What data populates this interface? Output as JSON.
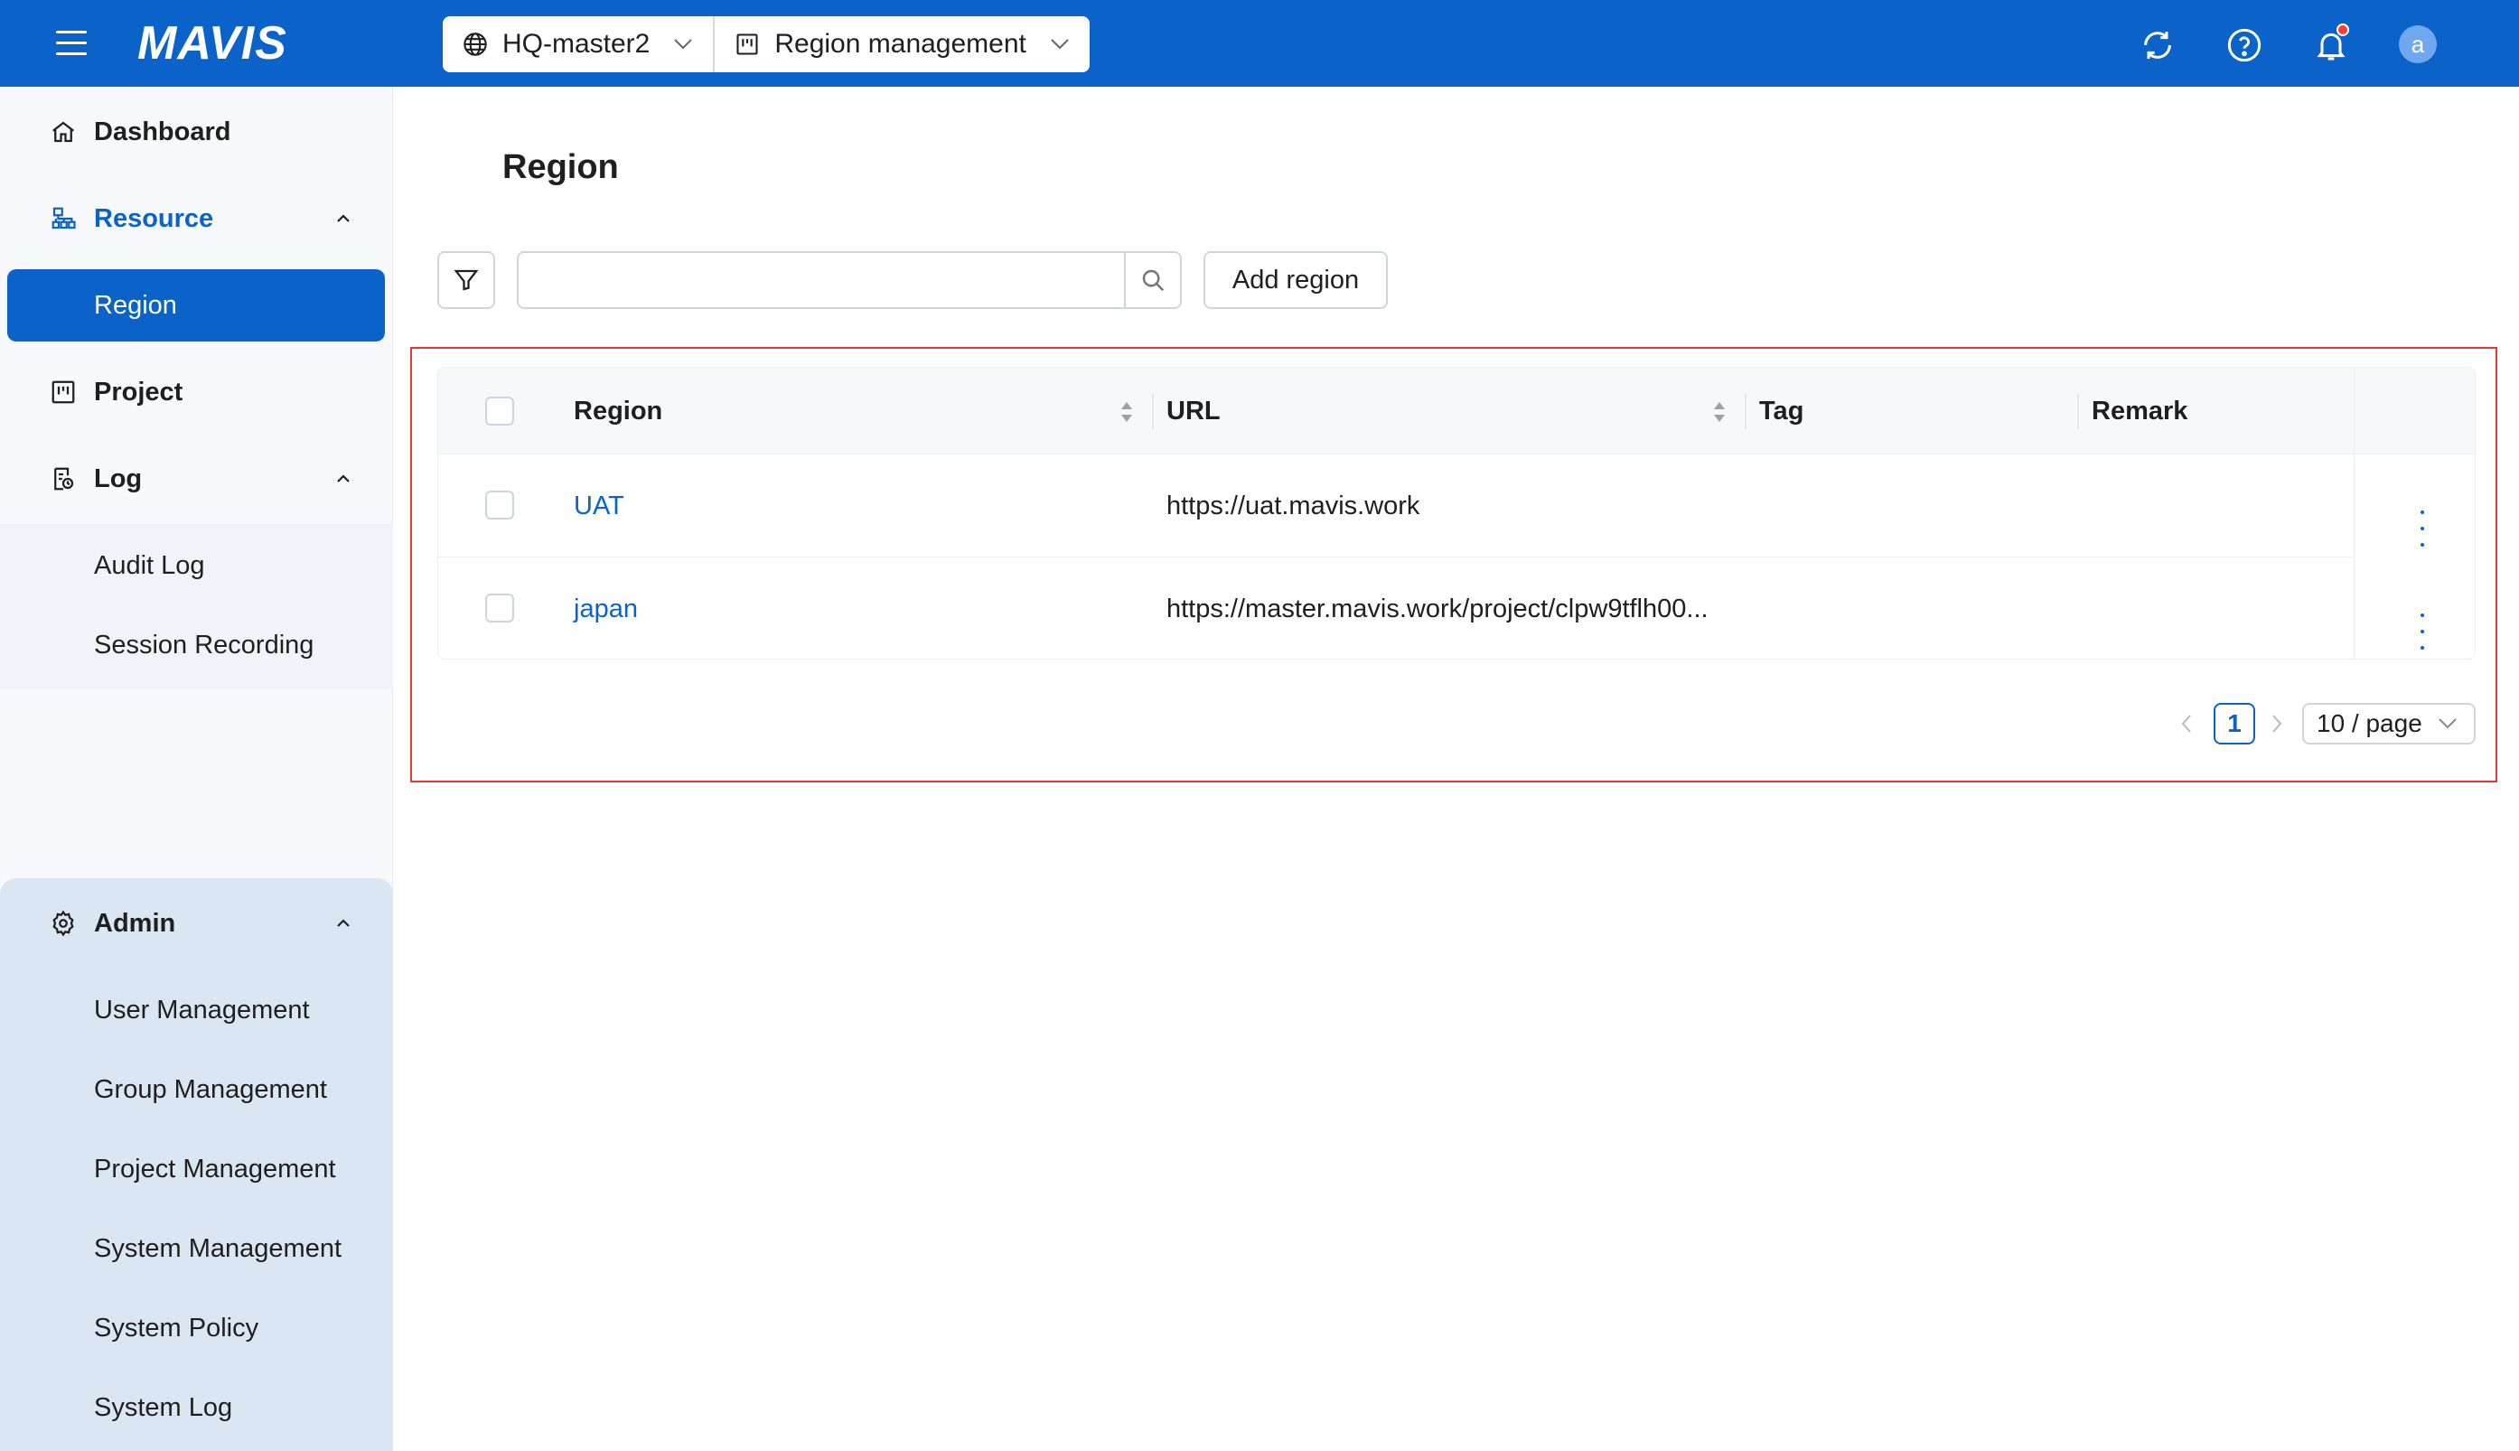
{
  "topbar": {
    "logo": "MAVIS",
    "region_select": "HQ-master2",
    "module_select": "Region management",
    "avatar_letter": "a",
    "icons": [
      "menu-icon",
      "refresh-icon",
      "help-icon",
      "bell-icon"
    ],
    "accent_color": "#0b63c9",
    "notification_dot_color": "#ff3b30"
  },
  "sidebar": {
    "dashboard": "Dashboard",
    "resource": "Resource",
    "region": "Region",
    "project": "Project",
    "log": "Log",
    "audit_log": "Audit Log",
    "session_recording": "Session Recording",
    "admin": "Admin",
    "admin_items": [
      "User Management",
      "Group Management",
      "Project Management",
      "System Management",
      "System Policy",
      "System Log"
    ]
  },
  "main": {
    "title": "Region",
    "search_placeholder": "",
    "add_button": "Add region",
    "table": {
      "columns": [
        "Region",
        "URL",
        "Tag",
        "Remark"
      ],
      "rows": [
        {
          "region": "UAT",
          "url": "https://uat.mavis.work",
          "tag": "",
          "remark": ""
        },
        {
          "region": "japan",
          "url": "https://master.mavis.work/project/clpw9tflh00...",
          "tag": "",
          "remark": ""
        }
      ]
    },
    "pagination": {
      "current_page": "1",
      "page_size": "10 / page"
    }
  }
}
